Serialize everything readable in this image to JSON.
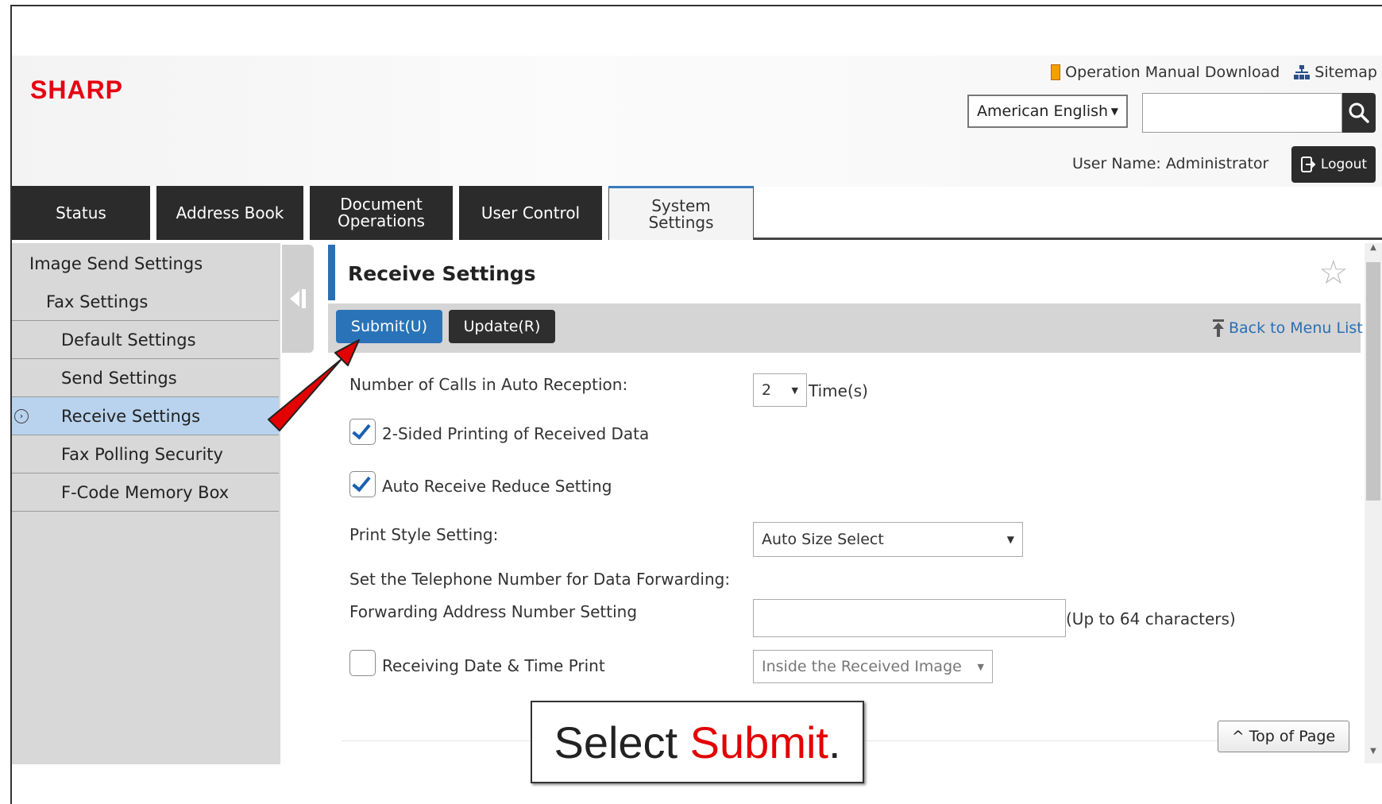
{
  "header": {
    "logo": "SHARP",
    "links": {
      "manual": "Operation Manual Download",
      "sitemap": "Sitemap"
    },
    "language": "American English",
    "search_value": "",
    "user_label": "User Name: Administrator",
    "logout_label": "Logout"
  },
  "tabs": [
    {
      "label": "Status"
    },
    {
      "label": "Address Book"
    },
    {
      "label": "Document Operations"
    },
    {
      "label": "User Control"
    },
    {
      "label": "System Settings"
    }
  ],
  "sidebar": {
    "items": [
      {
        "label": "Image Send Settings"
      },
      {
        "label": "Fax Settings"
      },
      {
        "label": "Default Settings"
      },
      {
        "label": "Send Settings"
      },
      {
        "label": "Receive Settings"
      },
      {
        "label": "Fax Polling Security"
      },
      {
        "label": "F-Code Memory Box"
      }
    ]
  },
  "main": {
    "title": "Receive Settings",
    "submit_label": "Submit(U)",
    "update_label": "Update(R)",
    "back_label": "Back to Menu List",
    "fields": {
      "calls_label": "Number of Calls in Auto Reception:",
      "calls_value": "2",
      "calls_unit": "Time(s)",
      "two_sided_label": "2-Sided Printing of Received Data",
      "auto_reduce_label": "Auto Receive Reduce Setting",
      "print_style_label": "Print Style Setting:",
      "print_style_value": "Auto Size Select",
      "forward_heading": "Set the Telephone Number for Data Forwarding:",
      "forward_label": "Forwarding Address Number Setting",
      "forward_value": "",
      "forward_hint": "(Up to 64 characters)",
      "datetime_label": "Receiving Date & Time Print",
      "datetime_value": "Inside the Received Image"
    },
    "top_of_page": "Top of Page"
  },
  "caption": {
    "prefix": "Select ",
    "highlight": "Submit",
    "suffix": "."
  },
  "colors": {
    "brand": "#e60012",
    "accent": "#2a73b8",
    "dark": "#2b2b2b",
    "selected": "#b9d3ee"
  }
}
